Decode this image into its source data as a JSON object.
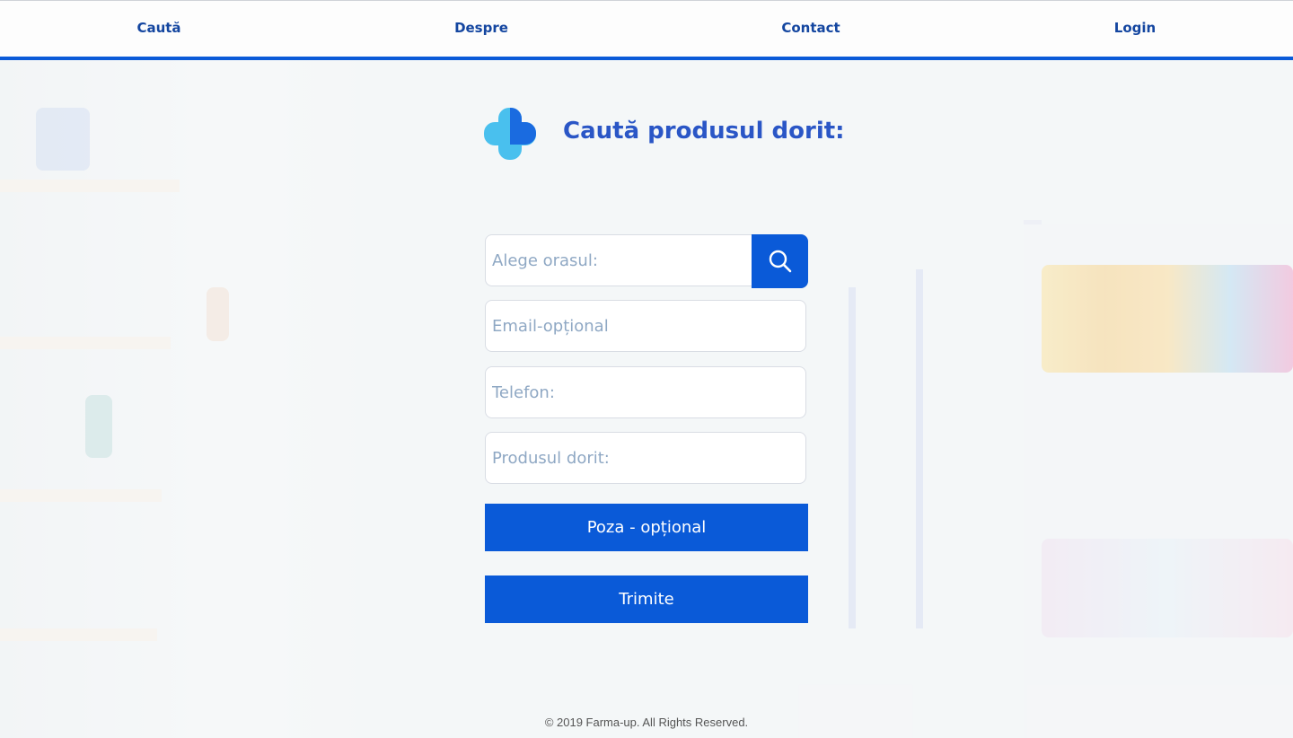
{
  "nav": {
    "items": [
      {
        "label": "Caută"
      },
      {
        "label": "Despre"
      },
      {
        "label": "Contact"
      },
      {
        "label": "Login"
      }
    ]
  },
  "main": {
    "title": "Caută produsul dorit:",
    "fields": {
      "city_placeholder": "Alege orasul:",
      "email_placeholder": "Email-opțional",
      "phone_placeholder": "Telefon:",
      "product_placeholder": "Produsul dorit:"
    },
    "photo_button_label": "Poza - opțional",
    "submit_button_label": "Trimite"
  },
  "footer": {
    "copyright": "© 2019 Farma-up. All Rights Reserved."
  },
  "colors": {
    "accent": "#0a5ad8",
    "title": "#2a56c6",
    "nav_text": "#1446a0",
    "logo_light": "#49c0ee",
    "logo_dark": "#1a6be0"
  },
  "icons": [
    "plus-cross-logo",
    "search-icon"
  ]
}
